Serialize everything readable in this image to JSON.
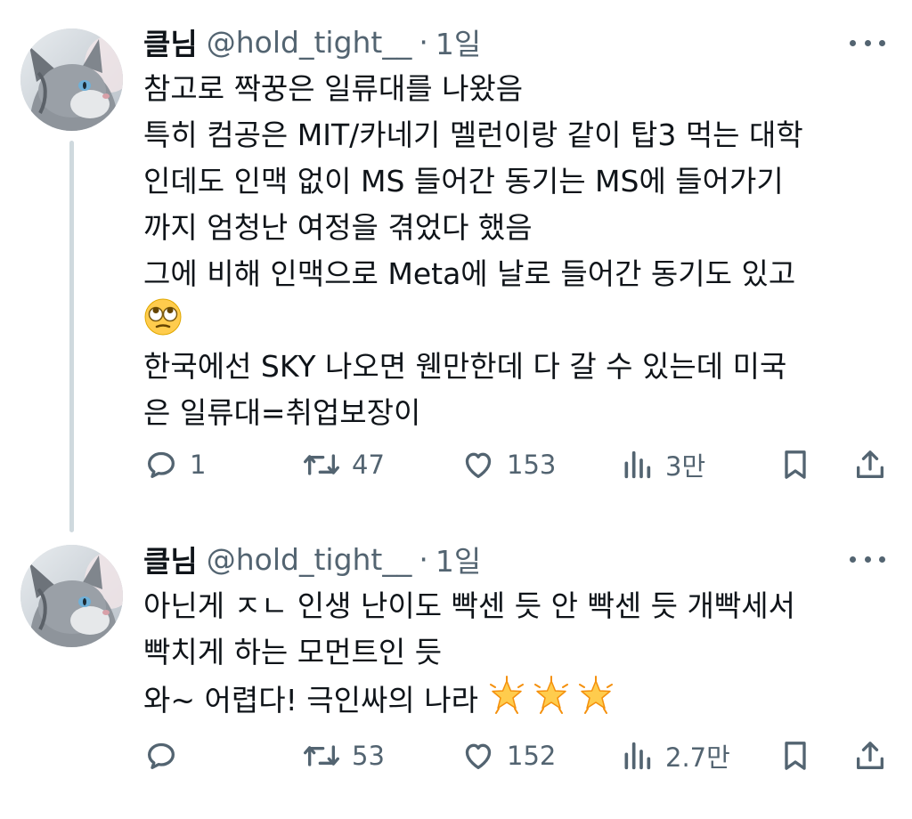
{
  "colors": {
    "text": "#0f1419",
    "secondary": "#536471",
    "thread_line": "#cfd9de"
  },
  "tweets": [
    {
      "name": "클님",
      "handle": "@hold_tight__",
      "separator": "·",
      "time": "1일",
      "lines": [
        "참고로 짝꿍은 일류대를 나왔음",
        "특히 컴공은 MIT/카네기 멜런이랑 같이 탑3 먹는 대학",
        "인데도 인맥 없이 MS 들어간 동기는 MS에 들어가기",
        "까지 엄청난 여정을 겪었다 했음",
        "그에 비해 인맥으로 Meta에 날로 들어간 동기도 있고",
        "",
        "한국에선 SKY 나오면 웬만한데 다 갈 수 있는데 미국",
        "은 일류대=취업보장이"
      ],
      "emoji_after_line_5": "rolling-eyes-emoji",
      "stats": {
        "replies": "1",
        "retweets": "47",
        "likes": "153",
        "views": "3만"
      }
    },
    {
      "name": "클님",
      "handle": "@hold_tight__",
      "separator": "·",
      "time": "1일",
      "lines": [
        "아닌게 ㅈㄴ 인생 난이도 빡센 듯 안 빡센 듯 개빡세서",
        "빡치게 하는 모먼트인 듯",
        "와~ 어렵다! 극인싸의 나라"
      ],
      "emoji_after_line_3": "glowing-star-emoji x3",
      "stats": {
        "replies": "",
        "retweets": "53",
        "likes": "152",
        "views": "2.7만"
      }
    }
  ]
}
